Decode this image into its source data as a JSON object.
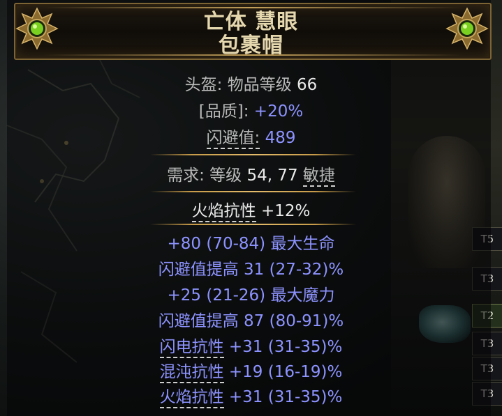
{
  "item": {
    "name_line1": "亡体 慧眼",
    "name_line2": "包裹帽"
  },
  "properties": {
    "type_label": "头盔:",
    "item_level_label": "物品等级",
    "item_level_value": "66",
    "quality_label": "[品质]:",
    "quality_value": "+20%",
    "evasion_label": "闪避值:",
    "evasion_value": "489"
  },
  "requirements": {
    "label": "需求:",
    "level_label": "等级",
    "level_value": "54,",
    "dex_value": "77",
    "dex_label": "敏捷"
  },
  "implicit": {
    "keyword": "火焰抗性",
    "value": "+12%"
  },
  "mods": [
    {
      "text": "+80 (70-84) 最大生命",
      "tier": "T5"
    },
    {
      "text": "闪避值提高 31 (27-32)%",
      "tier": "T3"
    },
    {
      "text": "+25 (21-26) 最大魔力",
      "tier": ""
    },
    {
      "text": "闪避值提高 87 (80-91)%",
      "tier": "T2"
    },
    {
      "keyword": "闪电抗性",
      "value": "+31 (31-35)%",
      "tier": "T3"
    },
    {
      "keyword": "混沌抗性",
      "value": "+19 (16-19)%",
      "tier": "T3"
    },
    {
      "keyword": "火焰抗性",
      "value": "+31 (31-35)%",
      "tier": "T3"
    }
  ],
  "colors": {
    "title": "#e6d8ae",
    "magic_blue": "#8d93ff",
    "border_gold": "#7d6434",
    "highlight_tier": "#24301c"
  },
  "icons": [
    "green-orb-icon",
    "gold-ornament-icon"
  ]
}
